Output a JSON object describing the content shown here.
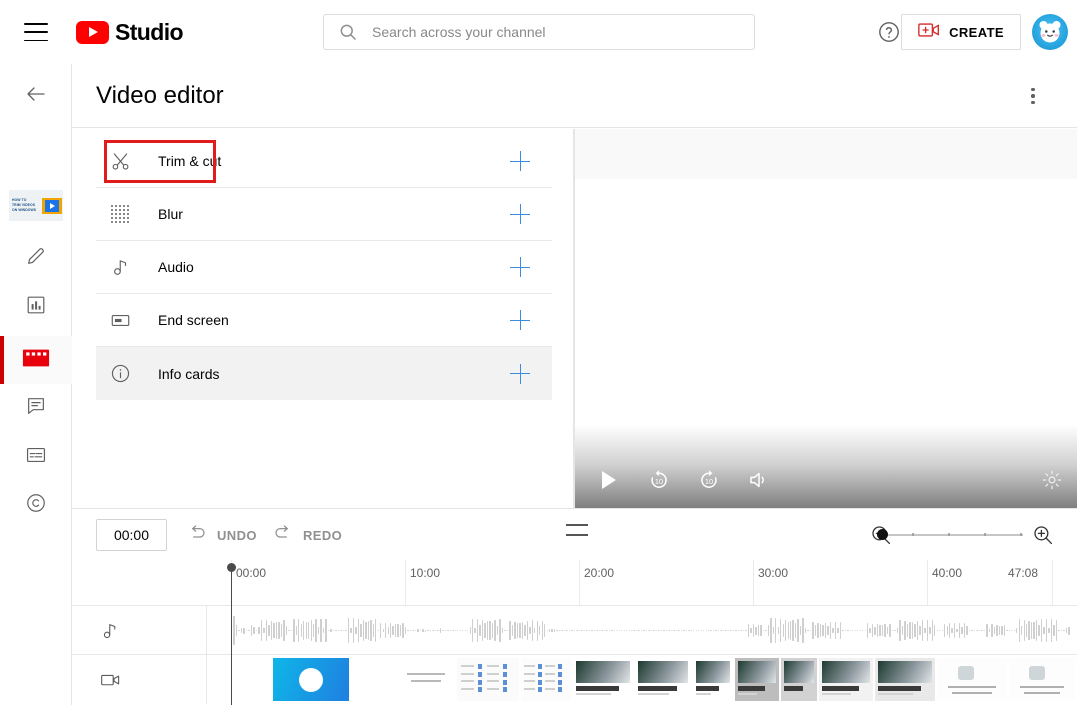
{
  "header": {
    "menu_icon": "hamburger-menu-icon",
    "brand": "Studio",
    "logo_icon": "youtube-logo-icon",
    "search": {
      "placeholder": "Search across your channel",
      "value": "",
      "icon": "search-icon"
    },
    "help_icon": "help-circle-icon",
    "create": {
      "label": "CREATE",
      "icon": "video-plus-icon"
    },
    "avatar": {
      "name": "channel-avatar",
      "color": "#29a6e0"
    }
  },
  "rail": {
    "back_icon": "back-arrow-icon",
    "thumbnail": {
      "line1": "HOW TO",
      "line2": "TRIM VIDEOS",
      "line3": "ON WINDOWS"
    },
    "items": [
      {
        "name": "details",
        "icon": "pencil-icon",
        "active": false
      },
      {
        "name": "analytics",
        "icon": "bar-chart-icon",
        "active": false
      },
      {
        "name": "editor",
        "icon": "clapperboard-icon",
        "active": true
      },
      {
        "name": "comments",
        "icon": "comment-icon",
        "active": false
      },
      {
        "name": "subtitles",
        "icon": "subtitles-icon",
        "active": false
      },
      {
        "name": "copyright",
        "icon": "copyright-icon",
        "active": false
      }
    ]
  },
  "page": {
    "title": "Video editor",
    "options_icon": "more-vertical-icon"
  },
  "tools": [
    {
      "label": "Trim & cut",
      "icon": "scissors-icon",
      "add_icon": "plus-icon",
      "hovered": false,
      "highlighted": true
    },
    {
      "label": "Blur",
      "icon": "blur-dots-icon",
      "add_icon": "plus-icon",
      "hovered": false,
      "highlighted": false
    },
    {
      "label": "Audio",
      "icon": "music-note-icon",
      "add_icon": "plus-icon",
      "hovered": false,
      "highlighted": false
    },
    {
      "label": "End screen",
      "icon": "end-screen-icon",
      "add_icon": "plus-icon",
      "hovered": false,
      "highlighted": false
    },
    {
      "label": "Info cards",
      "icon": "info-circle-icon",
      "add_icon": "plus-icon",
      "hovered": true,
      "highlighted": false
    }
  ],
  "player": {
    "play_icon": "play-icon",
    "rewind_label": "10",
    "rewind_icon": "rewind-10-icon",
    "forward_label": "10",
    "forward_icon": "forward-10-icon",
    "volume_icon": "volume-icon",
    "settings_icon": "gear-icon"
  },
  "editor_bar": {
    "timecode": "00:00",
    "undo": {
      "label": "UNDO",
      "icon": "undo-arrow-icon",
      "disabled": true
    },
    "redo": {
      "label": "REDO",
      "icon": "redo-arrow-icon",
      "disabled": true
    },
    "grip_icon": "drag-handle-icon",
    "zoom_out_icon": "zoom-out-icon",
    "zoom_in_icon": "zoom-in-icon",
    "zoom_value": 0,
    "zoom_ticks": 4
  },
  "timeline": {
    "playhead_time": "00:00",
    "duration": "47:08",
    "ruler_labels": [
      "00:00",
      "10:00",
      "20:00",
      "30:00",
      "40:00",
      "47:08"
    ],
    "tracks": [
      {
        "name": "audio-track",
        "icon": "music-note-icon"
      },
      {
        "name": "video-track",
        "icon": "video-camera-icon"
      }
    ]
  }
}
